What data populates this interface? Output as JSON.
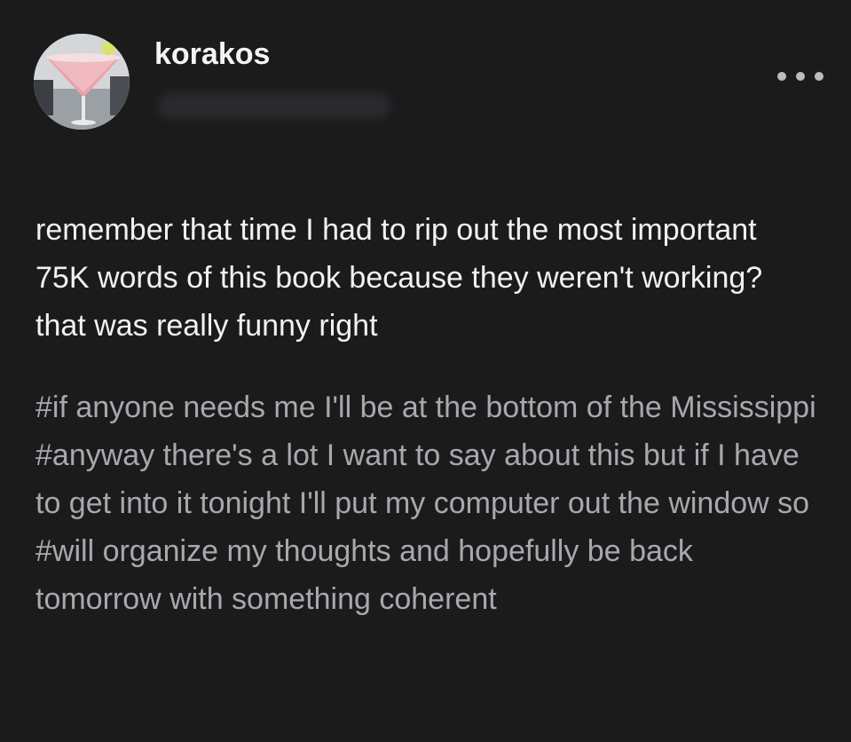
{
  "post": {
    "author": {
      "username": "korakos",
      "avatar_icon": "cocktail-glass-avatar"
    },
    "menu_icon": "more-horizontal-icon",
    "body": "remember that time I had to rip out the most important 75K words of this book because they weren't working? that was really funny right",
    "tags": [
      "#if anyone needs me I'll be at the bottom of the Mississippi",
      "#anyway there's a lot I want to say about this but if I have to get into it tonight I'll put my computer out the window so",
      "#will organize my thoughts and hopefully be back tomorrow with something coherent"
    ]
  },
  "colors": {
    "background": "#1b1b1c",
    "text": "#f2f2f2",
    "tag_text": "#a9a9ab"
  }
}
